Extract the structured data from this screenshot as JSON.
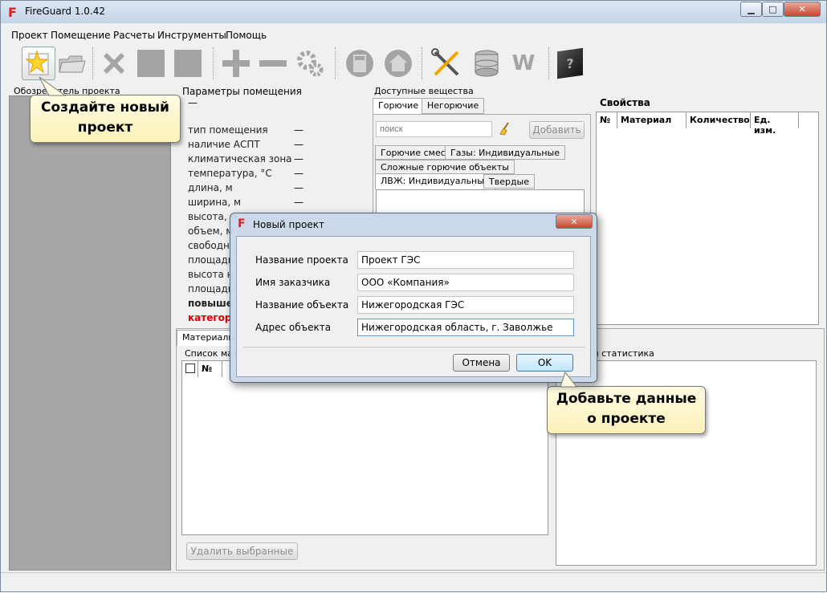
{
  "window": {
    "title": "FireGuard 1.0.42",
    "logo_letter": "F"
  },
  "window_controls": {
    "minimize": "▁",
    "maximize": "□",
    "close": "✕"
  },
  "menu": [
    "Проект",
    "Помещение",
    "Расчеты",
    "Инструменты",
    "Помощь"
  ],
  "toolbar": {
    "icons": [
      "new-project-icon",
      "open-project-icon",
      "delete-icon",
      "square-icon",
      "square-icon",
      "plus-icon",
      "minus-icon",
      "gears-icon",
      "calculator-icon",
      "home-icon",
      "tools-icon",
      "database-icon",
      "word-icon",
      "help-cube-icon"
    ],
    "word_glyph": "W",
    "help_glyph": "?"
  },
  "left_panel": {
    "title": "Обозреватель проекта"
  },
  "params": {
    "title": "Параметры помещения",
    "dash": "—",
    "rows": [
      {
        "label": "тип помещения",
        "value": "—"
      },
      {
        "label": "наличие АСПТ",
        "value": "—"
      },
      {
        "label": "климатическая зона",
        "value": "—"
      },
      {
        "label": "температура, °С",
        "value": "—"
      },
      {
        "label": "длина, м",
        "value": "—"
      },
      {
        "label": "ширина, м",
        "value": "—"
      },
      {
        "label": "высота, м",
        "value": ""
      },
      {
        "label": "объем, м",
        "value": ""
      },
      {
        "label": "свободн",
        "value": ""
      },
      {
        "label": "площадь",
        "value": ""
      },
      {
        "label": "высота н",
        "value": ""
      },
      {
        "label": "площадь",
        "value": ""
      }
    ],
    "bold_row": "повыше",
    "red_row": "категор"
  },
  "substances": {
    "title": "Доступные вещества",
    "tabs": [
      "Горючие",
      "Негорючие"
    ],
    "search_placeholder": "поиск",
    "add_button": "Добавить",
    "subtabs_row1": [
      "Горючие смеси",
      "Газы: Индивидуальные"
    ],
    "subtabs_row2": [
      "Сложные горючие объекты"
    ],
    "subtabs_row3": [
      "ЛВЖ: Индивидуальные",
      "Твердые"
    ]
  },
  "properties": {
    "title": "Свойства",
    "columns": [
      "№",
      "Материал",
      "Количество",
      "Ед. изм."
    ]
  },
  "materials": {
    "tab_label": "Материалы",
    "list_title": "Список мате",
    "columns": [
      "№"
    ],
    "delete_button": "Удалить выбранные",
    "stats_title": "я статистика"
  },
  "callouts": {
    "create": "Создайте новый проект",
    "add": "Добавьте данные о проекте"
  },
  "dialog": {
    "title": "Новый проект",
    "fields": [
      {
        "label": "Название проекта",
        "value": "Проект ГЭС"
      },
      {
        "label": "Имя заказчика",
        "value": "ООО «Компания»"
      },
      {
        "label": "Название объекта",
        "value": "Нижегородская ГЭС"
      },
      {
        "label": "Адрес объекта",
        "value": "Нижегородская область, г. Заволжье"
      }
    ],
    "cancel": "Отмена",
    "ok": "OK"
  }
}
